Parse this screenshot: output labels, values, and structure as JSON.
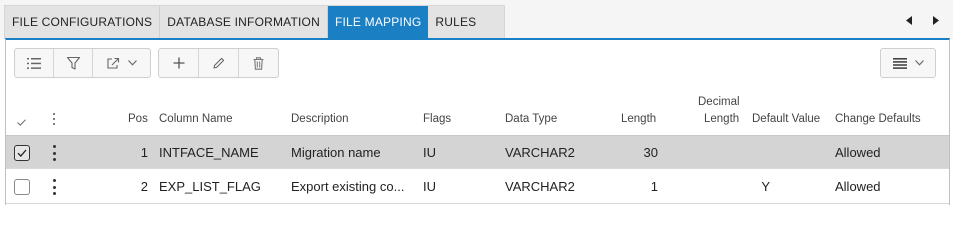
{
  "tabs": [
    {
      "label": "FILE CONFIGURATIONS",
      "active": false
    },
    {
      "label": "DATABASE INFORMATION",
      "active": false
    },
    {
      "label": "FILE MAPPING",
      "active": true
    },
    {
      "label": "RULES",
      "active": false
    }
  ],
  "toolbar": {
    "icons": [
      "list-icon",
      "filter-icon",
      "export-icon",
      "chevron-down-icon",
      "add-icon",
      "edit-icon",
      "delete-icon",
      "columns-menu-icon"
    ]
  },
  "grid": {
    "columns": {
      "select": "",
      "actions": "",
      "pos": "Pos",
      "column_name": "Column Name",
      "description": "Description",
      "flags": "Flags",
      "data_type": "Data Type",
      "length": "Length",
      "decimal_length_1": "Decimal",
      "decimal_length_2": "Length",
      "default_value": "Default Value",
      "change_defaults": "Change Defaults"
    },
    "rows": [
      {
        "selected": true,
        "pos": "1",
        "column_name": "INTFACE_NAME",
        "description": "Migration name",
        "flags": "IU",
        "data_type": "VARCHAR2",
        "length": "30",
        "decimal_length": "",
        "default_value": "",
        "change_defaults": "Allowed"
      },
      {
        "selected": false,
        "pos": "2",
        "column_name": "EXP_LIST_FLAG",
        "description": "Export existing co...",
        "flags": "IU",
        "data_type": "VARCHAR2",
        "length": "1",
        "decimal_length": "",
        "default_value": "Y",
        "change_defaults": "Allowed"
      }
    ]
  },
  "colors": {
    "accent": "#1b7fc4",
    "selected_row": "#d4d4d4"
  }
}
